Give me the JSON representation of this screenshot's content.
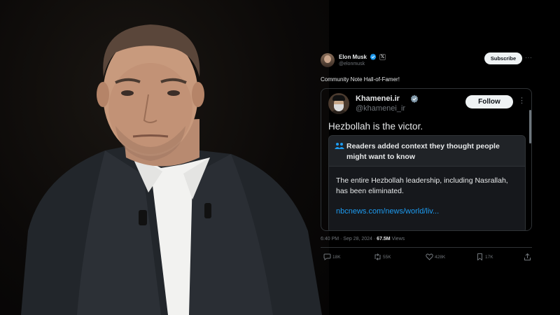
{
  "tweet": {
    "author_name": "Elon Musk",
    "author_handle": "@elonmusk",
    "subscribe_label": "Subscribe",
    "more_label": "···",
    "text": "Community Note Hall-of-Famer!",
    "timestamp": "6:40 PM · Sep 28, 2024 · ",
    "views_count": "67.5M",
    "views_label": " Views",
    "actions": {
      "replies": "18K",
      "reposts": "55K",
      "likes": "428K",
      "bookmarks": "17K"
    }
  },
  "quoted": {
    "author_name": "Khamenei.ir",
    "author_handle": "@khamenei_ir",
    "follow_label": "Follow",
    "more_label": "⋮",
    "text": "Hezbollah is the victor.",
    "community_note": {
      "title": "Readers added context they thought people might want to know",
      "body": "The entire Hezbollah leadership, including Nasrallah, has been eliminated.",
      "link": "nbcnews.com/news/world/liv..."
    }
  },
  "icons": {
    "verified": "verified-badge-icon",
    "x_logo": "x-logo-icon",
    "reply": "reply-icon",
    "repost": "repost-icon",
    "like": "heart-icon",
    "bookmark": "bookmark-icon",
    "share": "share-icon",
    "note": "people-icon"
  },
  "colors": {
    "background": "#000000",
    "accent": "#1d9bf0",
    "text": "#e7e9ea",
    "muted": "#71767b",
    "border": "#2f3336"
  }
}
